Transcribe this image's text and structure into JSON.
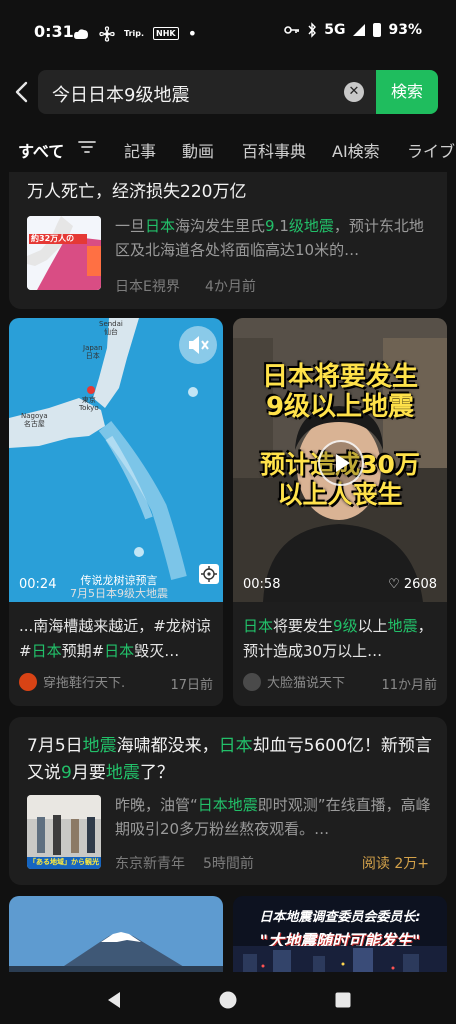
{
  "status_bar": {
    "time": "0:31",
    "app_icons": [
      "cloud-icon",
      "fan-icon",
      "trip-icon",
      "nhk-icon",
      "dot"
    ],
    "trip_label": "Trip.",
    "nhk_label": "NHK",
    "network": "5G",
    "battery": "93%"
  },
  "search": {
    "query": "今日日本9级地震",
    "submit_label": "検索"
  },
  "tabs": [
    {
      "label": "すべて",
      "active": true
    },
    {
      "label": "記事"
    },
    {
      "label": "動画"
    },
    {
      "label": "百科事典"
    },
    {
      "label": "AI検索"
    },
    {
      "label": "ライブ"
    }
  ],
  "article1": {
    "title_line": "万人死亡，经济损失220万亿",
    "snippet_parts": [
      "一旦",
      "日本",
      "海沟发生里氏",
      "9",
      ".1",
      "级地震",
      "，预计东北地区及北海道各处将面临高达10米的…"
    ],
    "thumb_text": "約32万人の",
    "source": "日本E視界",
    "date": "4か月前"
  },
  "video1": {
    "duration": "00:24",
    "overlay_line1": "传说龙树谅预言",
    "overlay_line2": "7月5日本9级大地震",
    "map_labels": {
      "sendai": "Sendai",
      "sendai_jp": "仙台",
      "japan": "Japan",
      "japan_jp": "日本",
      "tokyo": "東京",
      "tokyo_en": "Tokyo",
      "nagoya": "Nagoya",
      "nagoya_jp": "名古屋"
    },
    "title_parts": [
      "...南海槽越来越近，#龙树谅#",
      "日本",
      "预期#",
      "日本",
      "毁灭…"
    ],
    "author": "穿拖鞋行天下.",
    "date": "17日前"
  },
  "video2": {
    "duration": "00:58",
    "likes": "2608",
    "overlay_line1": "日本将要发生",
    "overlay_line2": "9级以上地震",
    "overlay_line3": "预计造成30万",
    "overlay_line4": "以上人丧生",
    "title_parts": [
      "日本",
      "将要发生",
      "9级",
      "以上",
      "地震",
      "，预计造成30万以上…"
    ],
    "author": "大脸猫说天下",
    "date": "11か月前"
  },
  "article2": {
    "title_parts": [
      "7月5日",
      "地震",
      "海啸都没来，",
      "日本",
      "却血亏5600亿！新预言又说",
      "9",
      "月要",
      "地震",
      "了？"
    ],
    "snippet_parts": [
      "昨晚，油管“",
      "日本地震",
      "即时观测”在线直播，高峰期吸引20多万粉丝熬夜观看。…"
    ],
    "thumb_caption": "「ある地域」から観光",
    "source": "东京新青年",
    "date": "5時間前",
    "read_label": "阅读 2万+"
  },
  "bottom_cards": {
    "right_line1": "日本地震调查委员会委员长:",
    "right_line2": "\"大地震随时可能发生\""
  },
  "colors": {
    "accent": "#22c069",
    "background": "#111111",
    "card": "#1e1e1e"
  }
}
